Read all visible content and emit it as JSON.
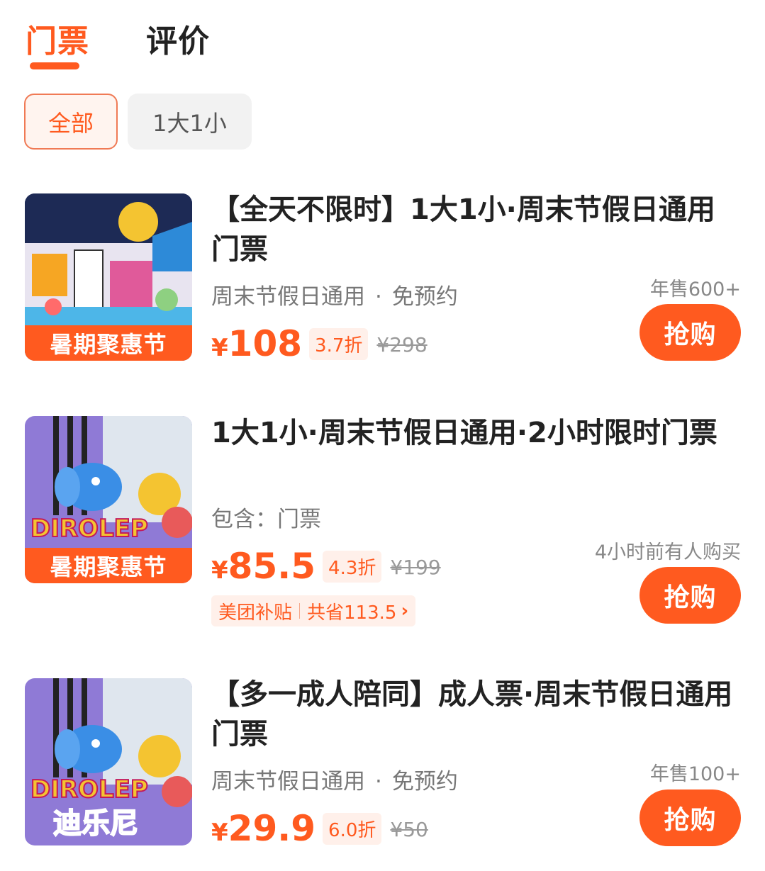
{
  "tabs": [
    {
      "label": "门票",
      "active": true
    },
    {
      "label": "评价",
      "active": false
    }
  ],
  "filters": [
    {
      "label": "全部",
      "selected": true
    },
    {
      "label": "1大1小",
      "selected": false
    }
  ],
  "accent_color": "#ff5a1f",
  "products": [
    {
      "title": "【全天不限时】1大1小·周末节假日通用门票",
      "meta_a": "周末节假日通用",
      "meta_dot": "·",
      "meta_b": "免预约",
      "promo_banner": "暑期聚惠节",
      "currency": "¥",
      "price": "108",
      "discount": "3.7折",
      "original_price": "¥298",
      "sales": "年售600+",
      "buy_label": "抢购"
    },
    {
      "title": "1大1小·周末节假日通用·2小时限时门票",
      "meta_a": "包含：门票",
      "promo_banner": "暑期聚惠节",
      "logo_text": "DIROLEP",
      "currency": "¥",
      "price": "85.5",
      "discount": "4.3折",
      "original_price": "¥199",
      "sales": "4小时前有人购买",
      "subsidy_a": "美团补贴",
      "subsidy_b": "共省113.5",
      "buy_label": "抢购"
    },
    {
      "title": "【多一成人陪同】成人票·周末节假日通用门票",
      "meta_a": "周末节假日通用",
      "meta_dot": "·",
      "meta_b": "免预约",
      "logo_text": "DIROLEP",
      "logo_cn": "迪乐尼",
      "currency": "¥",
      "price": "29.9",
      "discount": "6.0折",
      "original_price": "¥50",
      "sales": "年售100+",
      "buy_label": "抢购"
    }
  ]
}
